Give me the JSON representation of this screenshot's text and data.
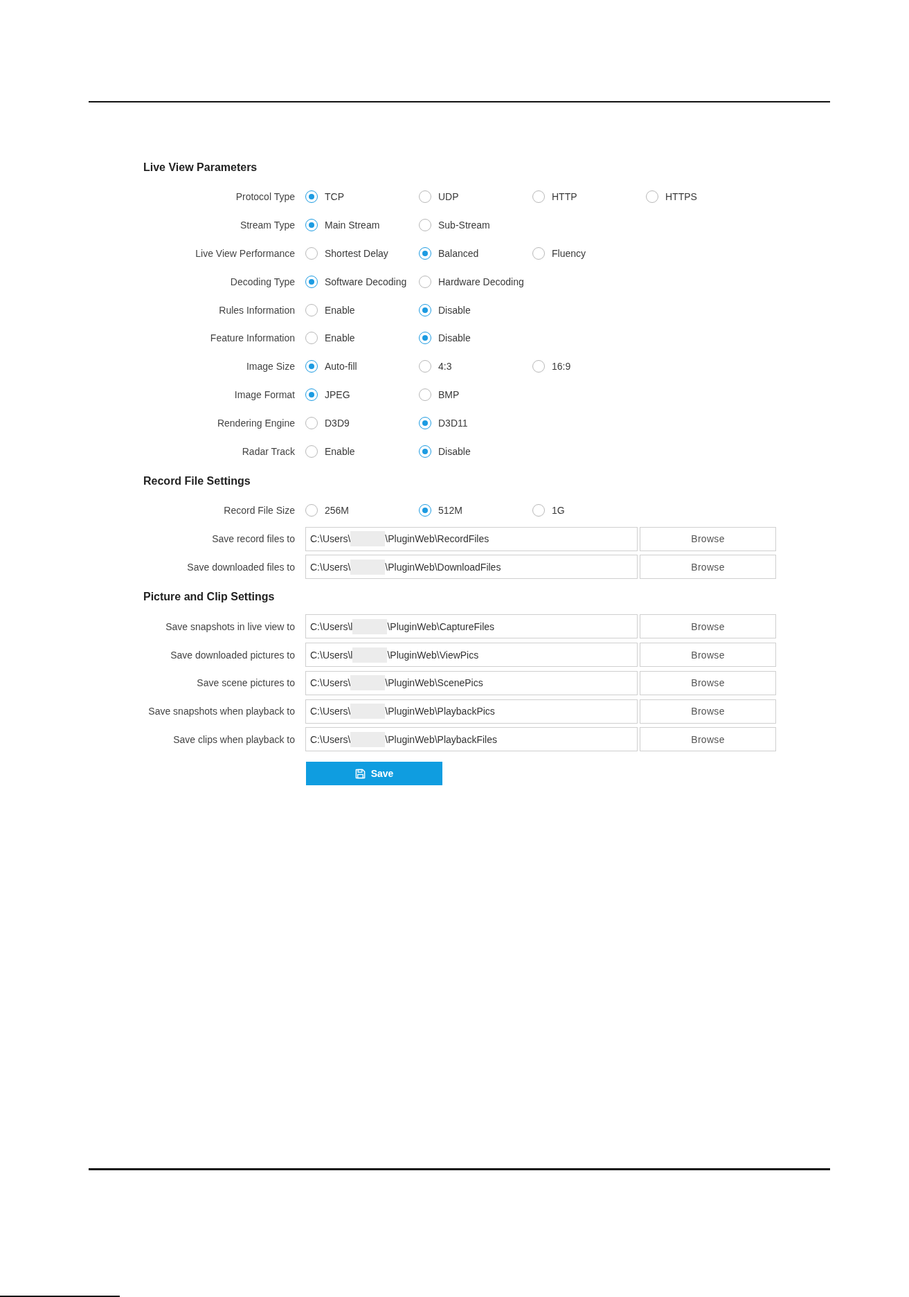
{
  "sections": [
    {
      "title": "Live View Parameters",
      "rows": [
        {
          "kind": "radio",
          "label": "Protocol Type",
          "options": [
            {
              "label": "TCP",
              "selected": true
            },
            {
              "label": "UDP",
              "selected": false
            },
            {
              "label": "HTTP",
              "selected": false
            },
            {
              "label": "HTTPS",
              "selected": false
            }
          ]
        },
        {
          "kind": "radio",
          "label": "Stream Type",
          "options": [
            {
              "label": "Main Stream",
              "selected": true
            },
            {
              "label": "Sub-Stream",
              "selected": false
            }
          ]
        },
        {
          "kind": "radio",
          "label": "Live View Performance",
          "options": [
            {
              "label": "Shortest Delay",
              "selected": false
            },
            {
              "label": "Balanced",
              "selected": true
            },
            {
              "label": "Fluency",
              "selected": false
            }
          ]
        },
        {
          "kind": "radio",
          "label": "Decoding Type",
          "options": [
            {
              "label": "Software Decoding",
              "selected": true
            },
            {
              "label": "Hardware Decoding",
              "selected": false
            }
          ]
        },
        {
          "kind": "radio",
          "label": "Rules Information",
          "options": [
            {
              "label": "Enable",
              "selected": false
            },
            {
              "label": "Disable",
              "selected": true
            }
          ]
        },
        {
          "kind": "radio",
          "label": "Feature Information",
          "options": [
            {
              "label": "Enable",
              "selected": false
            },
            {
              "label": "Disable",
              "selected": true
            }
          ]
        },
        {
          "kind": "radio",
          "label": "Image Size",
          "options": [
            {
              "label": "Auto-fill",
              "selected": true
            },
            {
              "label": "4:3",
              "selected": false
            },
            {
              "label": "16:9",
              "selected": false
            }
          ]
        },
        {
          "kind": "radio",
          "label": "Image Format",
          "options": [
            {
              "label": "JPEG",
              "selected": true
            },
            {
              "label": "BMP",
              "selected": false
            }
          ]
        },
        {
          "kind": "radio",
          "label": "Rendering Engine",
          "options": [
            {
              "label": "D3D9",
              "selected": false
            },
            {
              "label": "D3D11",
              "selected": true
            }
          ]
        },
        {
          "kind": "radio",
          "label": "Radar Track",
          "options": [
            {
              "label": "Enable",
              "selected": false
            },
            {
              "label": "Disable",
              "selected": true
            }
          ]
        }
      ]
    },
    {
      "title": "Record File Settings",
      "rows": [
        {
          "kind": "radio",
          "label": "Record File Size",
          "options": [
            {
              "label": "256M",
              "selected": false
            },
            {
              "label": "512M",
              "selected": true
            },
            {
              "label": "1G",
              "selected": false
            }
          ]
        },
        {
          "kind": "path",
          "label": "Save record files to",
          "value_start": "C:\\Users\\",
          "redacted": true,
          "value_end": "\\PluginWeb\\RecordFiles",
          "button": "Browse"
        },
        {
          "kind": "path",
          "label": "Save downloaded files to",
          "value_start": "C:\\Users\\",
          "redacted": true,
          "value_end": "\\PluginWeb\\DownloadFiles",
          "button": "Browse"
        }
      ]
    },
    {
      "title": "Picture and Clip Settings",
      "rows": [
        {
          "kind": "path",
          "label": "Save snapshots in live view to",
          "value_start": "C:\\Users\\l",
          "redacted": true,
          "value_end": "\\PluginWeb\\CaptureFiles",
          "button": "Browse"
        },
        {
          "kind": "path",
          "label": "Save downloaded pictures to",
          "value_start": "C:\\Users\\l",
          "redacted": true,
          "value_end": "\\PluginWeb\\ViewPics",
          "button": "Browse"
        },
        {
          "kind": "path",
          "label": "Save scene pictures to",
          "value_start": "C:\\Users\\",
          "redacted": true,
          "value_end": "\\PluginWeb\\ScenePics",
          "button": "Browse"
        },
        {
          "kind": "path",
          "label": "Save snapshots when playback to",
          "value_start": "C:\\Users\\",
          "redacted": true,
          "value_end": "\\PluginWeb\\PlaybackPics",
          "button": "Browse"
        },
        {
          "kind": "path",
          "label": "Save clips when playback to",
          "value_start": "C:\\Users\\",
          "redacted": true,
          "value_end": "\\PluginWeb\\PlaybackFiles",
          "button": "Browse"
        }
      ]
    }
  ],
  "save_button": {
    "label": "Save"
  }
}
